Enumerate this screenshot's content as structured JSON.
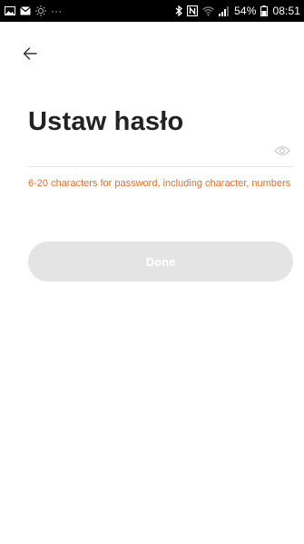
{
  "status_bar": {
    "left_icons": [
      "gallery-icon",
      "mail-icon",
      "settings-brightness-icon"
    ],
    "more_indicator": "···",
    "right_icons": [
      "bluetooth-icon",
      "nfc-icon",
      "wifi-icon",
      "signal-icon",
      "battery-icon"
    ],
    "battery_percent": "54%",
    "time": "08:51"
  },
  "nav": {
    "back_icon": "arrow-left-icon"
  },
  "page": {
    "title": "Ustaw hasło",
    "password_field": {
      "value": "",
      "placeholder": "",
      "toggle_icon": "eye-icon"
    },
    "hint": "6-20 characters for password, including character, numbers",
    "done_label": "Done"
  },
  "colors": {
    "status_bar_bg": "#000000",
    "hint_text": "#e0702a",
    "button_disabled_bg": "#e4e4e4",
    "title_text": "#222222"
  }
}
